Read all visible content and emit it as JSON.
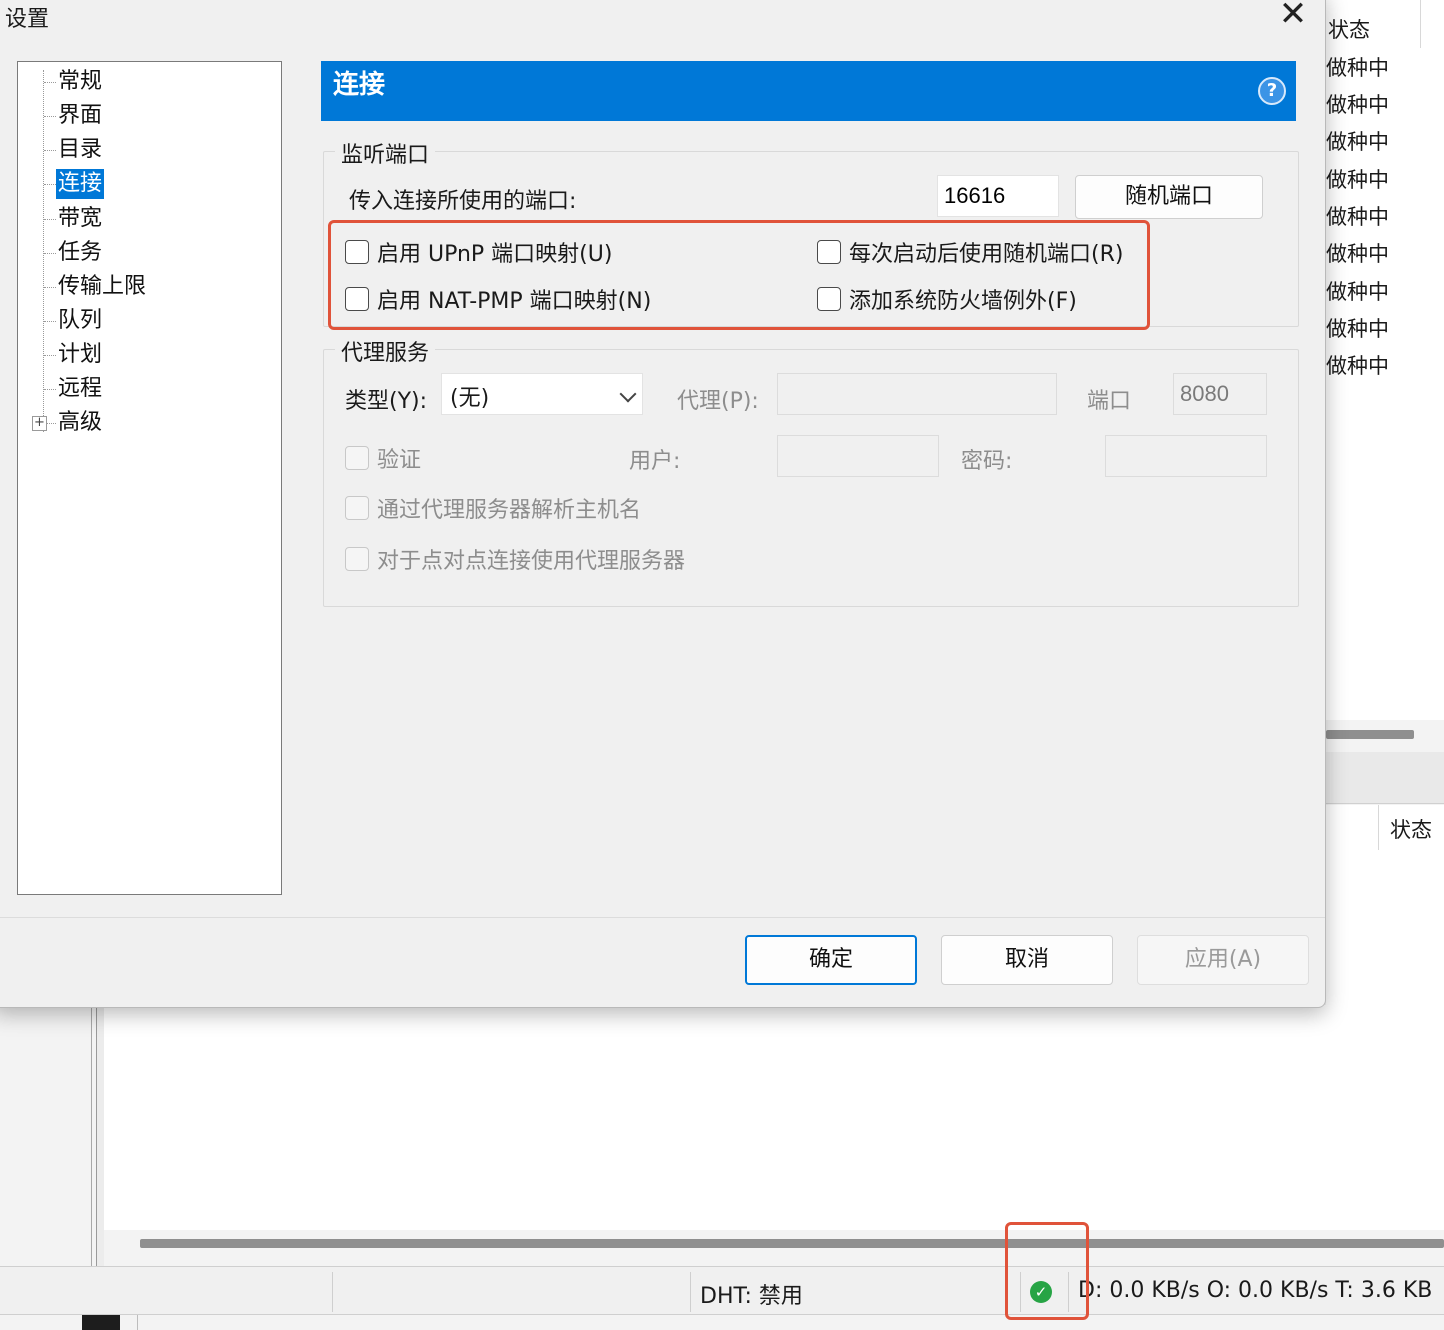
{
  "background": {
    "list_header": "状态",
    "status_items": [
      "做种中",
      "做种中",
      "做种中",
      "做种中",
      "做种中",
      "做种中",
      "做种中",
      "做种中",
      "做种中"
    ],
    "lower_header": "状态",
    "statusbar": {
      "dht": "DHT: 禁用",
      "speed": "D: 0.0 KB/s O: 0.0 KB/s T: 3.6 KB"
    }
  },
  "dialog": {
    "title": "设置",
    "close_symbol": "✕",
    "nav": {
      "items": [
        {
          "label": "常规"
        },
        {
          "label": "界面"
        },
        {
          "label": "目录"
        },
        {
          "label": "连接"
        },
        {
          "label": "带宽"
        },
        {
          "label": "任务"
        },
        {
          "label": "传输上限"
        },
        {
          "label": "队列"
        },
        {
          "label": "计划"
        },
        {
          "label": "远程"
        },
        {
          "label": "高级"
        }
      ],
      "selected": "连接",
      "expand_symbol": "+"
    },
    "page": {
      "title": "连接",
      "help_symbol": "?",
      "listen": {
        "legend": "监听端口",
        "port_label": "传入连接所使用的端口:",
        "port_value": "16616",
        "random_button": "随机端口",
        "upnp": "启用 UPnP 端口映射(U)",
        "random_on_start": "每次启动后使用随机端口(R)",
        "natpmp": "启用 NAT-PMP 端口映射(N)",
        "firewall": "添加系统防火墙例外(F)"
      },
      "proxy": {
        "legend": "代理服务",
        "type_label": "类型(Y):",
        "type_value": "(无)",
        "proxy_label": "代理(P):",
        "proxy_value": "",
        "port_label": "端口",
        "port_value": "8080",
        "auth": "验证",
        "user_label": "用户:",
        "user_value": "",
        "password_label": "密码:",
        "password_value": "",
        "resolve_hostnames": "通过代理服务器解析主机名",
        "p2p_proxy": "对于点对点连接使用代理服务器"
      }
    },
    "buttons": {
      "ok": "确定",
      "cancel": "取消",
      "apply": "应用(A)"
    }
  },
  "colors": {
    "accent": "#0078d7",
    "annotation": "#e0533a",
    "status_ok": "#27a445"
  }
}
